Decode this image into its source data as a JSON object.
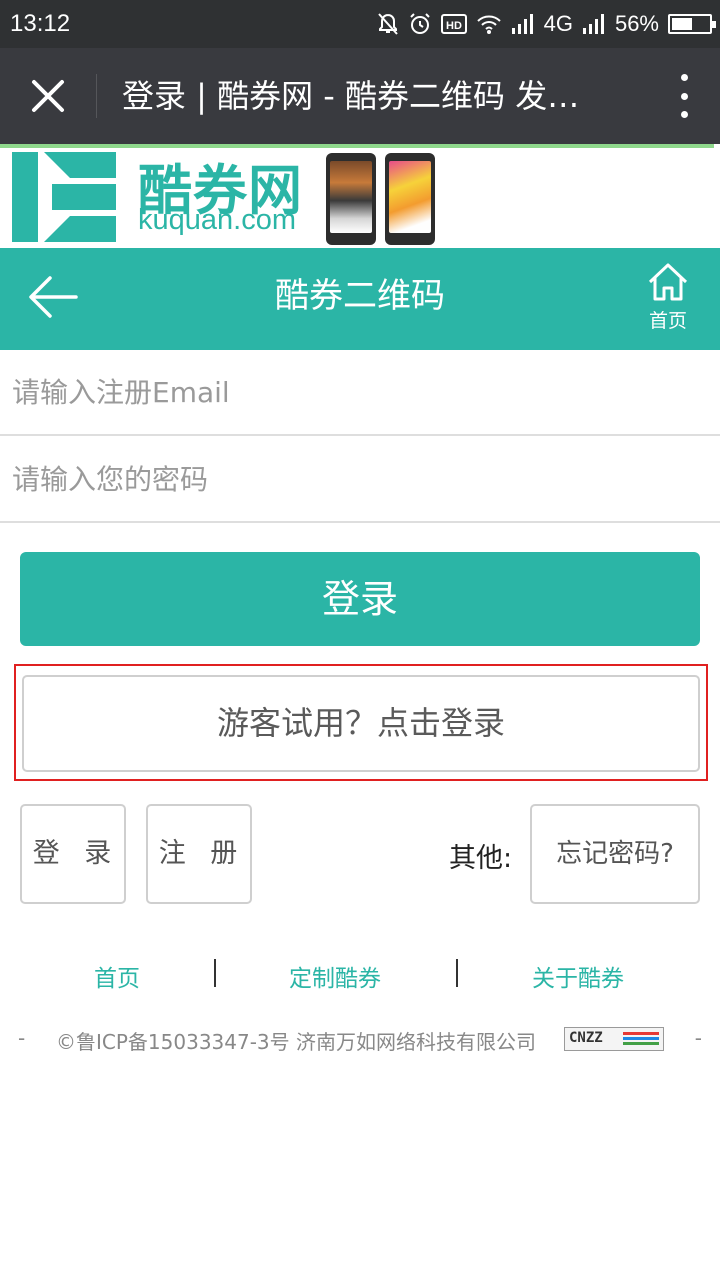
{
  "status_bar": {
    "time": "13:12",
    "network": "4G",
    "battery_percent": "56%",
    "battery_level": 0.56,
    "icons": [
      "mute-bell-icon",
      "alarm-icon",
      "hd-icon",
      "wifi-icon",
      "signal-icon",
      "signal-icon",
      "battery-icon"
    ]
  },
  "title_bar": {
    "title": "登录 | 酷券网 - 酷券二维码 发…",
    "close_icon": "close-icon",
    "more_icon": "more-vertical-icon"
  },
  "banner": {
    "logo_cn": "酷券网",
    "logo_en": "kuquan.com",
    "brand_color": "#2bb5a6"
  },
  "header": {
    "title": "酷券二维码",
    "home_label": "首页",
    "back_icon": "arrow-left-icon",
    "home_icon": "home-icon",
    "bg_color": "#2bb5a6"
  },
  "form": {
    "email_placeholder": "请输入注册Email",
    "password_placeholder": "请输入您的密码",
    "email_value": "",
    "password_value": ""
  },
  "buttons": {
    "login": "登录",
    "guest_login": "游客试用？点击登录",
    "small_login": "登 录",
    "register": "注 册",
    "other_label": "其他:",
    "forgot_password": "忘记密码?"
  },
  "footer": {
    "links": [
      "首页",
      "定制酷券",
      "关于酷券"
    ],
    "separator": "|",
    "dash": "-",
    "copyright": "©鲁ICP备15033347-3号 济南万如网络科技有限公司",
    "badge_text": "CNZZ"
  },
  "highlight_color": "#e02020"
}
